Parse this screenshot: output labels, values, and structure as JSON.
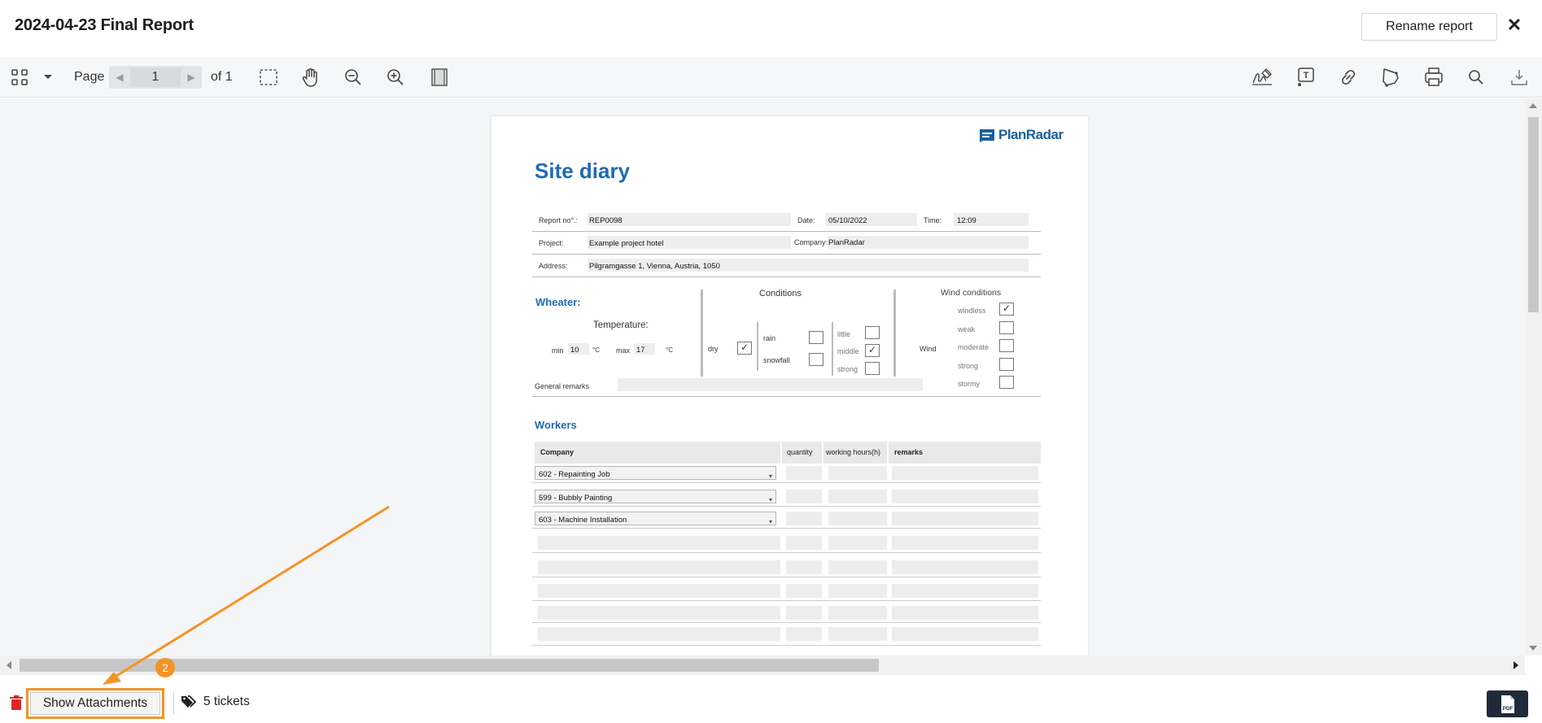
{
  "window": {
    "title": "2024-04-23 Final Report",
    "rename_label": "Rename report",
    "close_glyph": "✕"
  },
  "toolbar": {
    "page_label": "Page",
    "page_value": "1",
    "of_label": "of 1",
    "left_icons": [
      "thumbnails-grid-icon",
      "dropdown-caret-icon"
    ],
    "tools": [
      "marquee-select-icon",
      "pan-hand-icon",
      "zoom-out-icon",
      "zoom-in-icon",
      "fit-page-icon"
    ],
    "right_icons": [
      "signature-icon",
      "text-box-icon",
      "link-icon",
      "shape-icon",
      "print-icon",
      "search-icon",
      "download-icon"
    ]
  },
  "document": {
    "logo_text": "PlanRadar",
    "heading": "Site diary",
    "header_fields": {
      "report_no_label": "Report no°.:",
      "report_no": "REP0098",
      "date_label": "Date:",
      "date": "05/10/2022",
      "time_label": "Time:",
      "time": "12:09",
      "project_label": "Project:",
      "project": "Example project hotel",
      "company_label": "Company:",
      "company": "PlanRadar",
      "address_label": "Address:",
      "address": "Pilgramgasse 1, Vienna, Austria, 1050"
    },
    "weather": {
      "title": "Wheater:",
      "temperature_label": "Temperature:",
      "min_label": "min",
      "min_value": "10",
      "max_label": "max",
      "max_value": "17",
      "unit": "°C",
      "conditions_title": "Conditions",
      "dry_label": "dry",
      "rain_label": "rain",
      "snowfall_label": "snowfall",
      "little_label": "little",
      "middle_label": "middle",
      "strong_label": "strong",
      "wind_label": "Wind",
      "wind_title": "Wind conditions",
      "windless_label": "windless",
      "weak_label": "weak",
      "moderate_label": "moderate",
      "wind_strong_label": "strong",
      "stormy_label": "stormy",
      "general_remarks_label": "General remarks",
      "check_glyph": "✓"
    },
    "workers": {
      "title": "Workers",
      "columns": [
        "Company",
        "quantity",
        "working hours(h)",
        "remarks"
      ],
      "rows": [
        "602 - Repainting Job",
        "599 - Bubbly Painting",
        "603 - Machine Installation"
      ],
      "caret": "▾"
    }
  },
  "bottom": {
    "show_attachments_label": "Show Attachments",
    "tickets_label": "5 tickets",
    "pdf_label": "PDF"
  },
  "annotation": {
    "step_number": "2",
    "accent_color": "#f39424"
  }
}
